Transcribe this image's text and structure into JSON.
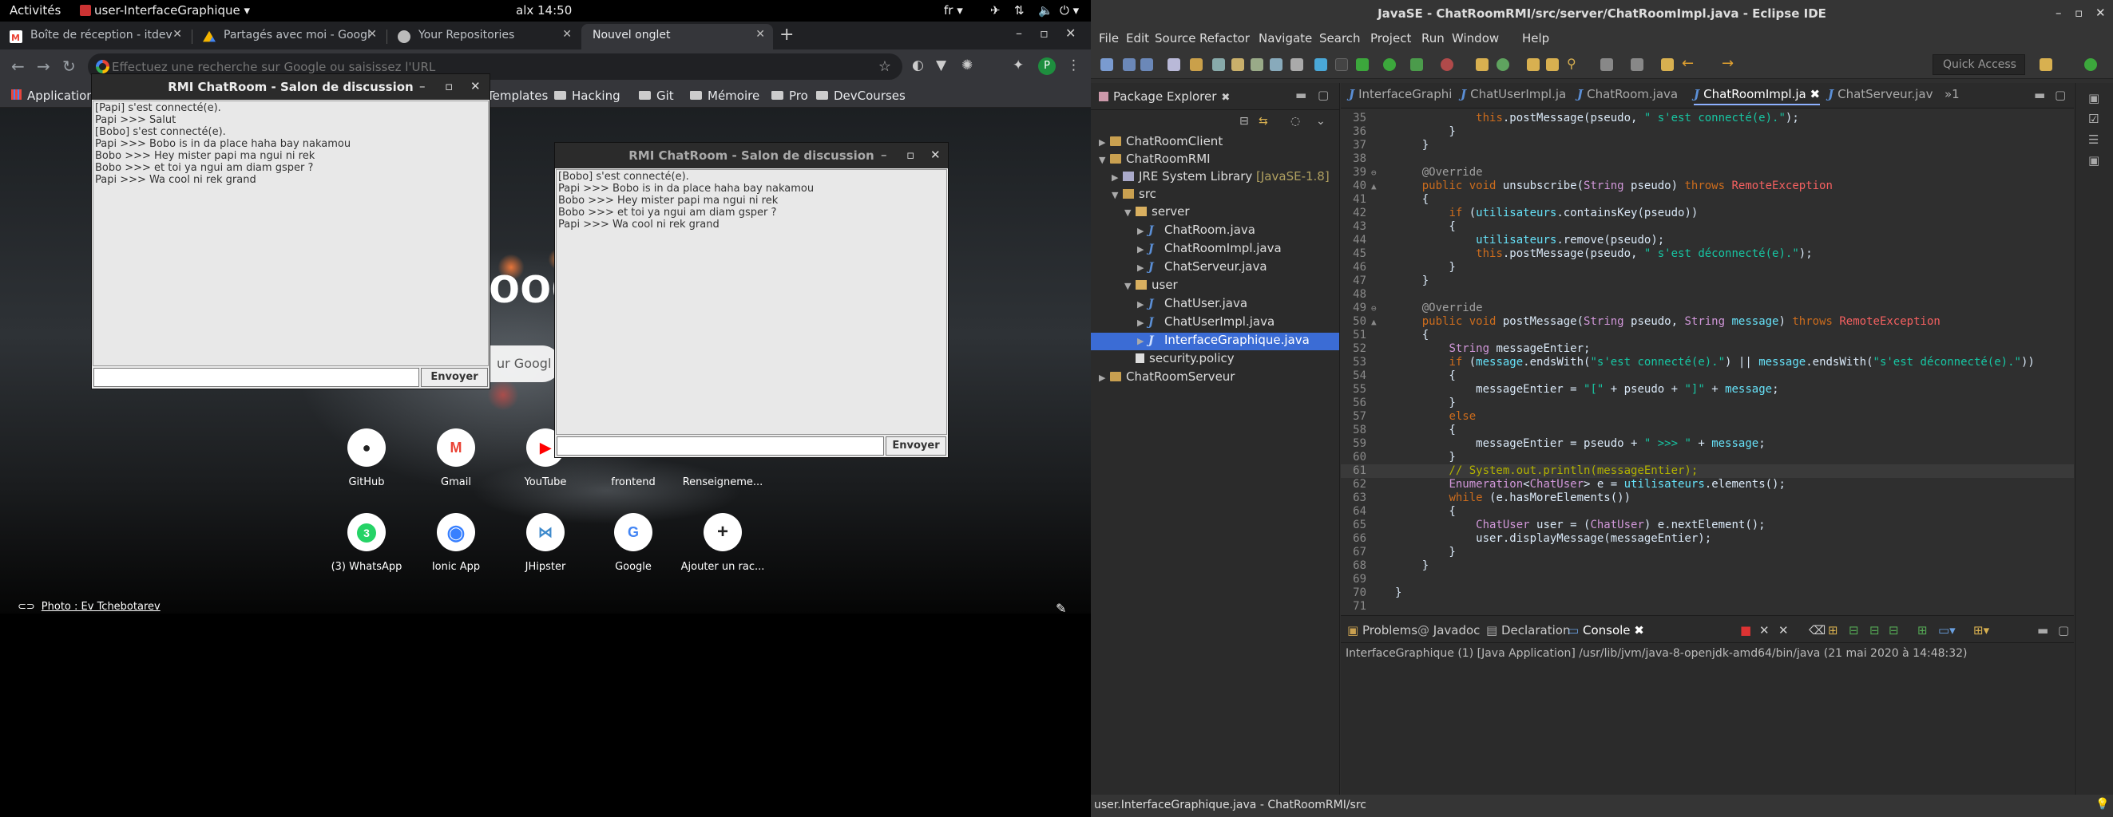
{
  "topbar": {
    "activities": "Activités",
    "app_menu": "user-InterfaceGraphique",
    "clock": "alx 14:50",
    "lang": "fr"
  },
  "chrome": {
    "tabs": [
      {
        "label": "Boîte de réception - itdev",
        "icon": "gmail-icon"
      },
      {
        "label": "Partagés avec moi - Googl",
        "icon": "drive-icon"
      },
      {
        "label": "Your Repositories",
        "icon": "github-icon"
      },
      {
        "label": "Nouvel onglet",
        "icon": "none"
      }
    ],
    "omnibox_placeholder": "Effectuez une recherche sur Google ou saisissez l'URL",
    "profile_initial": "P",
    "bookmarks": [
      "Applications",
      "Templates",
      "Hacking",
      "Git",
      "Mémoire",
      "Pro",
      "DevCourses"
    ],
    "ntp": {
      "logo_fragment": "oog",
      "search_fragment": "ur Googl",
      "tiles_row1": [
        {
          "label": "GitHub",
          "icon": "github-icon"
        },
        {
          "label": "Gmail",
          "icon": "gmail-icon"
        },
        {
          "label": "YouTube",
          "icon": "youtube-icon"
        },
        {
          "label": "frontend",
          "icon": "frontend-icon"
        },
        {
          "label": "Renseigneme...",
          "icon": "info-icon"
        }
      ],
      "tiles_row2": [
        {
          "label": "(3) WhatsApp",
          "icon": "whatsapp-icon",
          "badge": "3"
        },
        {
          "label": "Ionic App",
          "icon": "ionic-icon"
        },
        {
          "label": "JHipster",
          "icon": "jhipster-icon"
        },
        {
          "label": "Google",
          "icon": "google-icon"
        },
        {
          "label": "Ajouter un rac...",
          "icon": "plus-icon"
        }
      ],
      "photo_credit": "Photo : Ev Tchebotarev"
    }
  },
  "chat_windows": [
    {
      "title": "RMI ChatRoom - Salon de discussion",
      "messages": [
        "[Papi] s'est connecté(e).",
        "Papi >>> Salut",
        "[Bobo] s'est connecté(e).",
        "Papi >>> Bobo is in da place haha bay nakamou",
        "Bobo >>> Hey mister papi ma ngui ni rek",
        "Bobo >>> et toi ya ngui am diam gsper ?",
        "Papi >>> Wa cool ni rek grand"
      ],
      "input_value": "",
      "send_label": "Envoyer"
    },
    {
      "title": "RMI ChatRoom - Salon de discussion",
      "messages": [
        "[Bobo] s'est connecté(e).",
        "Papi >>> Bobo is in da place haha bay nakamou",
        "Bobo >>> Hey mister papi ma ngui ni rek",
        "Bobo >>> et toi ya ngui am diam gsper ?",
        "Papi >>> Wa cool ni rek grand"
      ],
      "input_value": "",
      "send_label": "Envoyer"
    }
  ],
  "eclipse": {
    "title": "JavaSE - ChatRoomRMI/src/server/ChatRoomImpl.java - Eclipse IDE",
    "menu": [
      "File",
      "Edit",
      "Source",
      "Refactor",
      "Navigate",
      "Search",
      "Project",
      "Run",
      "Window",
      "Help"
    ],
    "quick_access": "Quick Access",
    "package_explorer": {
      "title": "Package Explorer",
      "tree": [
        {
          "label": "ChatRoomClient",
          "depth": 0,
          "kind": "project",
          "expanded": false
        },
        {
          "label": "ChatRoomRMI",
          "depth": 0,
          "kind": "project",
          "expanded": true
        },
        {
          "label": "JRE System Library",
          "suffix": "[JavaSE-1.8]",
          "depth": 1,
          "kind": "library",
          "expanded": false
        },
        {
          "label": "src",
          "depth": 1,
          "kind": "srcfolder",
          "expanded": true
        },
        {
          "label": "server",
          "depth": 2,
          "kind": "package",
          "expanded": true
        },
        {
          "label": "ChatRoom.java",
          "depth": 3,
          "kind": "interface",
          "expanded": false
        },
        {
          "label": "ChatRoomImpl.java",
          "depth": 3,
          "kind": "java",
          "expanded": false
        },
        {
          "label": "ChatServeur.java",
          "depth": 3,
          "kind": "java",
          "expanded": false
        },
        {
          "label": "user",
          "depth": 2,
          "kind": "package",
          "expanded": true
        },
        {
          "label": "ChatUser.java",
          "depth": 3,
          "kind": "interface",
          "expanded": false
        },
        {
          "label": "ChatUserImpl.java",
          "depth": 3,
          "kind": "java",
          "expanded": false
        },
        {
          "label": "InterfaceGraphique.java",
          "depth": 3,
          "kind": "java",
          "expanded": false,
          "selected": true
        },
        {
          "label": "security.policy",
          "depth": 2,
          "kind": "file",
          "expanded": null
        },
        {
          "label": "ChatRoomServeur",
          "depth": 0,
          "kind": "project",
          "expanded": false
        }
      ]
    },
    "editor_tabs": [
      {
        "label": "InterfaceGraphi"
      },
      {
        "label": "ChatUserImpl.ja"
      },
      {
        "label": "ChatRoom.java"
      },
      {
        "label": "ChatRoomImpl.ja",
        "active": true
      },
      {
        "label": "ChatServeur.jav"
      },
      {
        "label": "»1"
      }
    ],
    "code_lines": [
      {
        "n": "35",
        "fold": "",
        "code": "            this.postMessage(pseudo, \" s'est connecté(e).\");"
      },
      {
        "n": "36",
        "fold": "",
        "code": "        }"
      },
      {
        "n": "37",
        "fold": "",
        "code": "    }"
      },
      {
        "n": "38",
        "fold": "",
        "code": ""
      },
      {
        "n": "39",
        "fold": "⊖",
        "code": "    @Override"
      },
      {
        "n": "40",
        "fold": "▲",
        "code": "    public void unsubscribe(String pseudo) throws RemoteException"
      },
      {
        "n": "41",
        "fold": "",
        "code": "    {"
      },
      {
        "n": "42",
        "fold": "",
        "code": "        if (utilisateurs.containsKey(pseudo))"
      },
      {
        "n": "43",
        "fold": "",
        "code": "        {"
      },
      {
        "n": "44",
        "fold": "",
        "code": "            utilisateurs.remove(pseudo);"
      },
      {
        "n": "45",
        "fold": "",
        "code": "            this.postMessage(pseudo, \" s'est déconnecté(e).\");"
      },
      {
        "n": "46",
        "fold": "",
        "code": "        }"
      },
      {
        "n": "47",
        "fold": "",
        "code": "    }"
      },
      {
        "n": "48",
        "fold": "",
        "code": ""
      },
      {
        "n": "49",
        "fold": "⊖",
        "code": "    @Override"
      },
      {
        "n": "50",
        "fold": "▲",
        "code": "    public void postMessage(String pseudo, String message) throws RemoteException"
      },
      {
        "n": "51",
        "fold": "",
        "code": "    {"
      },
      {
        "n": "52",
        "fold": "",
        "code": "        String messageEntier;"
      },
      {
        "n": "53",
        "fold": "",
        "code": "        if (message.endsWith(\"s'est connecté(e).\") || message.endsWith(\"s'est déconnecté(e).\"))"
      },
      {
        "n": "54",
        "fold": "",
        "code": "        {"
      },
      {
        "n": "55",
        "fold": "",
        "code": "            messageEntier = \"[\" + pseudo + \"]\" + message;"
      },
      {
        "n": "56",
        "fold": "",
        "code": "        }"
      },
      {
        "n": "57",
        "fold": "",
        "code": "        else"
      },
      {
        "n": "58",
        "fold": "",
        "code": "        {"
      },
      {
        "n": "59",
        "fold": "",
        "code": "            messageEntier = pseudo + \" >>> \" + message;"
      },
      {
        "n": "60",
        "fold": "",
        "code": "        }"
      },
      {
        "n": "61",
        "fold": "",
        "code": "        // System.out.println(messageEntier);",
        "highlight": true
      },
      {
        "n": "62",
        "fold": "",
        "code": "        Enumeration<ChatUser> e = utilisateurs.elements();"
      },
      {
        "n": "63",
        "fold": "",
        "code": "        while (e.hasMoreElements())"
      },
      {
        "n": "64",
        "fold": "",
        "code": "        {"
      },
      {
        "n": "65",
        "fold": "",
        "code": "            ChatUser user = (ChatUser) e.nextElement();"
      },
      {
        "n": "66",
        "fold": "",
        "code": "            user.displayMessage(messageEntier);"
      },
      {
        "n": "67",
        "fold": "",
        "code": "        }"
      },
      {
        "n": "68",
        "fold": "",
        "code": "    }"
      },
      {
        "n": "69",
        "fold": "",
        "code": ""
      },
      {
        "n": "70",
        "fold": "",
        "code": "}"
      },
      {
        "n": "71",
        "fold": "",
        "code": ""
      }
    ],
    "console_tabs": [
      {
        "label": "Problems"
      },
      {
        "label": "Javadoc"
      },
      {
        "label": "Declaration"
      },
      {
        "label": "Console",
        "active": true
      }
    ],
    "console_line": "InterfaceGraphique (1) [Java Application] /usr/lib/jvm/java-8-openjdk-amd64/bin/java (21 mai 2020 à 14:48:32)",
    "status": "user.InterfaceGraphique.java - ChatRoomRMI/src"
  }
}
